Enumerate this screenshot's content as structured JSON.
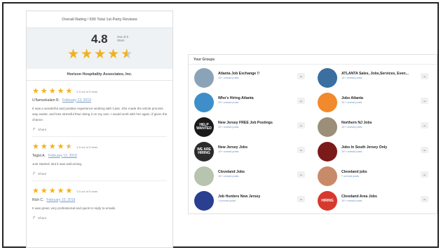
{
  "reviews_panel": {
    "header": "Overall Rating / 690 Total 1st-Party Reviews",
    "rating_value": "4.8",
    "rating_out_of": "Out of 5 Stars",
    "company": "Horizon Hospitality Associates, Inc.",
    "share_label": "Share",
    "items": [
      {
        "stars": 5,
        "score_text": "5.0 out of 5 stars",
        "author": "U'Ilamsokalam R.",
        "date": "February 13, 2019",
        "text": "It was a wonderful and positive experience working with Cass. She made the whole process way easier, and less stressful than doing it on my own. I would work with her again, if given the chance."
      },
      {
        "stars": 4.5,
        "score_text": "4.5 out of 5 stars",
        "author": "Tegist A.",
        "date": "February 12, 2019",
        "text": "Just Started. But it was welcoming."
      },
      {
        "stars": 5,
        "score_text": "5.0 out of 5 stars",
        "author": "Rich C.",
        "date": "February 10, 2019",
        "text": "It was great, very professional and quick to reply to emails."
      }
    ]
  },
  "groups_panel": {
    "title": "Your Groups",
    "more_glyph": "•••",
    "groups": [
      {
        "name": "Atlanta Job Exchange !!",
        "sub": "10+ unread posts",
        "thumb_text": "",
        "thumb_color": "#8aa3b8"
      },
      {
        "name": "ATLANTA Sales, Jobs,Services, Even...",
        "sub": "10+ unread posts",
        "thumb_text": "",
        "thumb_color": "#3a6fa0"
      },
      {
        "name": "Who's Hiring Atlanta",
        "sub": "10+ unread posts",
        "thumb_text": "",
        "thumb_color": "#3e8fc9"
      },
      {
        "name": "Jobs Atlanta",
        "sub": "10+ unread posts",
        "thumb_text": "",
        "thumb_color": "#f08a2c"
      },
      {
        "name": "New Jersey FREE Job Postings",
        "sub": "10+ unread posts",
        "thumb_text": "HELP WANTED",
        "thumb_color": "#1a1a1a"
      },
      {
        "name": "Northern NJ Jobs",
        "sub": "10+ unread posts",
        "thumb_text": "",
        "thumb_color": "#9b8f7a"
      },
      {
        "name": "New Jersey Jobs",
        "sub": "10+ unread posts",
        "thumb_text": "WE ARE HIRING",
        "thumb_color": "#2b2b2b"
      },
      {
        "name": "Jobs In South Jersey Only",
        "sub": "10+ unread posts",
        "thumb_text": "",
        "thumb_color": "#7a1a1a"
      },
      {
        "name": "Cleveland Jobs",
        "sub": "10+ unread posts",
        "thumb_text": "",
        "thumb_color": "#b7c4b0"
      },
      {
        "name": "Cleveland jobs",
        "sub": "7 unread posts",
        "thumb_text": "",
        "thumb_color": "#c98a6a"
      },
      {
        "name": "Job Hunters New Jersey",
        "sub": "1 unread posts",
        "thumb_text": "",
        "thumb_color": "#2a3f8f"
      },
      {
        "name": "Cleveland Area Jobs",
        "sub": "10+ unread posts",
        "thumb_text": "HIRING",
        "thumb_color": "#d63a2f"
      }
    ]
  },
  "colors": {
    "star": "#f0b21b",
    "link": "#7a9cc6",
    "rating_bg": "#eef2f5"
  }
}
